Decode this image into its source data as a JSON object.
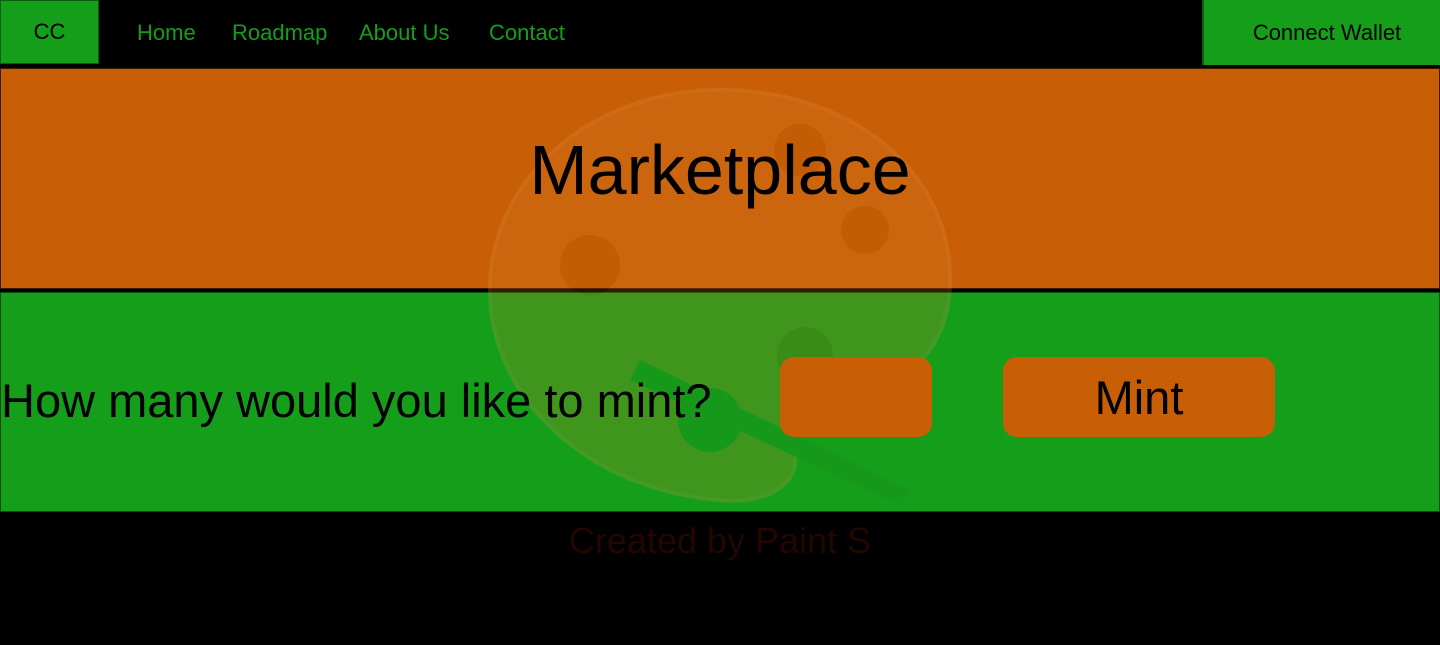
{
  "nav": {
    "logo": "CC",
    "links": [
      {
        "label": "Home"
      },
      {
        "label": "Roadmap"
      },
      {
        "label": "About Us"
      },
      {
        "label": "Contact"
      }
    ],
    "wallet_button": "Connect Wallet"
  },
  "hero": {
    "title": "Marketplace"
  },
  "mint": {
    "question": "How many would you like to mint?",
    "quantity_value": "",
    "button_label": "Mint"
  },
  "footer": {
    "text": "Created by Paint S"
  },
  "colors": {
    "green": "#159e1a",
    "orange": "#c85f06",
    "background": "#000000"
  },
  "icons": {
    "watermark": "paint-palette-icon"
  }
}
